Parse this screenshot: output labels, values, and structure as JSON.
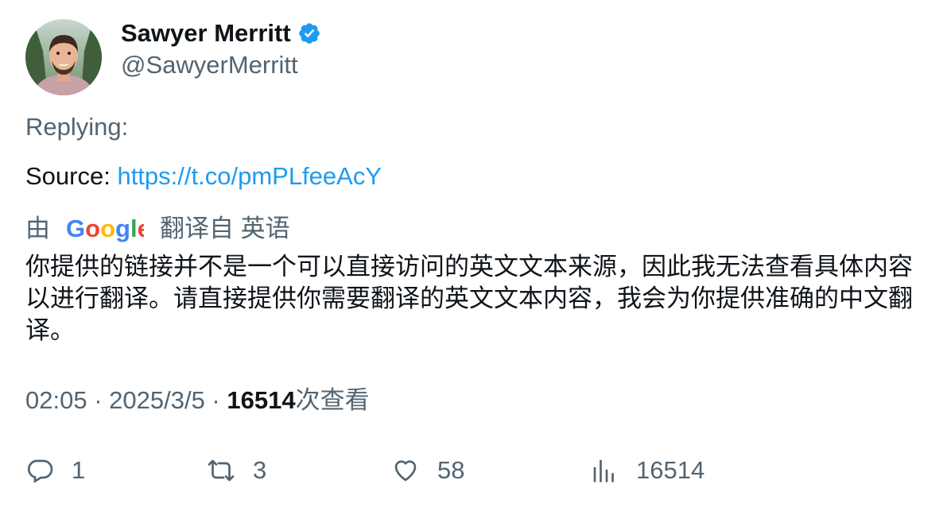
{
  "author": {
    "display_name": "Sawyer Merritt",
    "handle": "@SawyerMerritt",
    "verified_icon": "verified-badge-icon",
    "verified_color": "#1d9bf0"
  },
  "tweet": {
    "replying_label": "Replying:",
    "source_label": "Source: ",
    "source_link": "https://t.co/pmPLfeeAcY"
  },
  "translation": {
    "by_label": "由",
    "provider": "Google",
    "from_label": "翻译自 英语",
    "text": "你提供的链接并不是一个可以直接访问的英文文本来源，因此我无法查看具体内容以进行翻译。请直接提供你需要翻译的英文文本内容，我会为你提供准确的中文翻译。"
  },
  "meta": {
    "time": "02:05",
    "sep1": " · ",
    "date": "2025/3/5",
    "sep2": " · ",
    "views_count": "16514",
    "views_label": "次查看"
  },
  "actions": {
    "replies": "1",
    "retweets": "3",
    "likes": "58",
    "views": "16514"
  },
  "colors": {
    "link": "#1d9bf0",
    "secondary_text": "#536471",
    "primary_text": "#0f1419"
  }
}
